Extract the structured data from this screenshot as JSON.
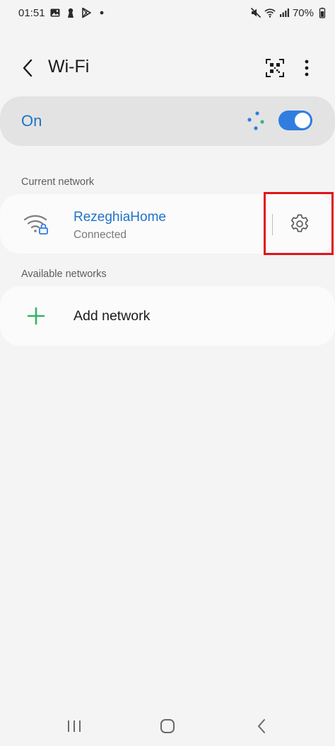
{
  "status_bar": {
    "time": "01:51",
    "battery": "70%"
  },
  "app_bar": {
    "title": "Wi-Fi"
  },
  "wifi_toggle": {
    "label": "On",
    "state": "on"
  },
  "sections": {
    "current": "Current network",
    "available": "Available networks"
  },
  "current_network": {
    "name": "RezeghiaHome",
    "status": "Connected"
  },
  "add_network": {
    "label": "Add network"
  },
  "colors": {
    "accent": "#1e73c9",
    "switch_on": "#2f7de1",
    "plus": "#2fb566",
    "highlight": "#e0141b"
  }
}
